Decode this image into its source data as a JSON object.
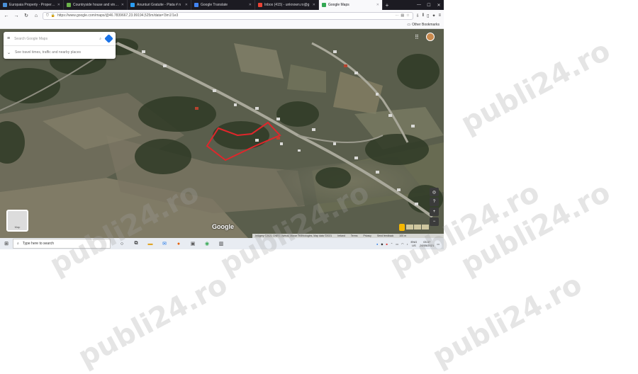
{
  "browser": {
    "tabs": [
      {
        "label": "Europaia Property - Properties",
        "color": "#4a90d9"
      },
      {
        "label": "Countryside house and vineyard",
        "color": "#6bb34a"
      },
      {
        "label": "Anunturi Gratuite - Piata # n",
        "color": "#2a9df4"
      },
      {
        "label": "Google Translate",
        "color": "#4285f4"
      },
      {
        "label": "Inbox (415) - unknown.ro@g",
        "color": "#ea4335"
      },
      {
        "label": "Google Maps",
        "color": "#34a853",
        "active": true
      }
    ],
    "new_tab_label": "+",
    "url": "https://www.google.com/maps/@46.7839667,23.99194,525m/data=!3m1!1e3",
    "bookmarks_label": "Other Bookmarks"
  },
  "map": {
    "search_placeholder": "Search Google Maps",
    "directions_hint": "See travel times, traffic and nearby places",
    "layers_label": "Map",
    "logo_text": "Google",
    "footer_items": [
      "Imagery ©2021 CNES / Airbus, Maxar Technologies, Map data ©2021",
      "Ireland",
      "Terms",
      "Privacy",
      "Send feedback",
      "100 m"
    ],
    "controls": [
      "+",
      "−",
      "?",
      "◎"
    ]
  },
  "taskbar": {
    "search_placeholder": "Type here to search",
    "lang": "ENG",
    "lang_sub": "US",
    "time": "03:37",
    "date": "24/05/2021"
  },
  "watermark": "publi24.ro",
  "colors": {
    "plot_outline": "#e0262b",
    "taskbar": "#e8ecf2",
    "tab_dark": "#1c1b22"
  }
}
